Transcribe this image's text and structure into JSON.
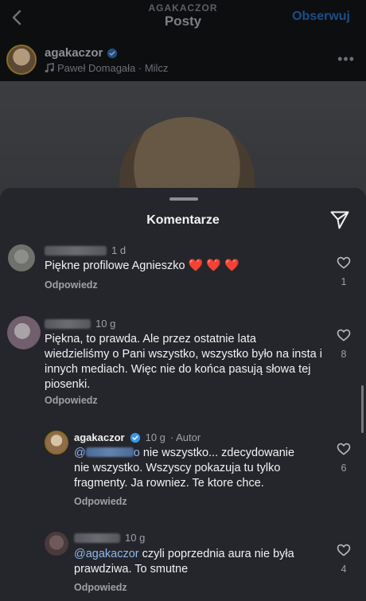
{
  "topbar": {
    "account": "AGAKACZOR",
    "title": "Posty",
    "follow_label": "Obserwuj"
  },
  "post": {
    "username": "agakaczor",
    "music": "Paweł Domagała · Milcz",
    "more_label": "•••"
  },
  "sheet": {
    "title": "Komentarze"
  },
  "comments": [
    {
      "time": "1 d",
      "text": "Piękne profilowe Agnieszko",
      "hearts": "❤️ ❤️ ❤️",
      "reply_label": "Odpowiedz",
      "likes": "1"
    },
    {
      "time": "10 g",
      "text": "Piękna, to prawda. Ale przez ostatnie lata wiedzieliśmy o Pani wszystko, wszystko było na insta i innych mediach. Więc nie do końca pasują słowa tej piosenki.",
      "reply_label": "Odpowiedz",
      "likes": "8"
    },
    {
      "username": "agakaczor",
      "time": "10 g",
      "author_badge": "· Autor",
      "mention_prefix": "@",
      "mention_suffix": "o",
      "text": " nie wszystko... zdecydowanie nie wszystko. Wszyscy pokazuja tu tylko fragmenty. Ja rowniez. Te ktore chce.",
      "reply_label": "Odpowiedz",
      "likes": "6"
    },
    {
      "time": "10 g",
      "mention": "@agakaczor",
      "text": " czyli poprzednia aura nie była prawdziwa. To smutne",
      "reply_label": "Odpowiedz",
      "likes": "4"
    }
  ],
  "colors": {
    "sheet_bg": "#25262b",
    "mention": "#8fb7f0",
    "verified": "#3897f0",
    "follow": "#1a4f89",
    "heart_emoji": "#ff2a3c"
  },
  "icons": [
    "back-chevron-icon",
    "verified-badge-icon",
    "music-note-icon",
    "more-dots-icon",
    "send-icon",
    "heart-outline-icon"
  ]
}
